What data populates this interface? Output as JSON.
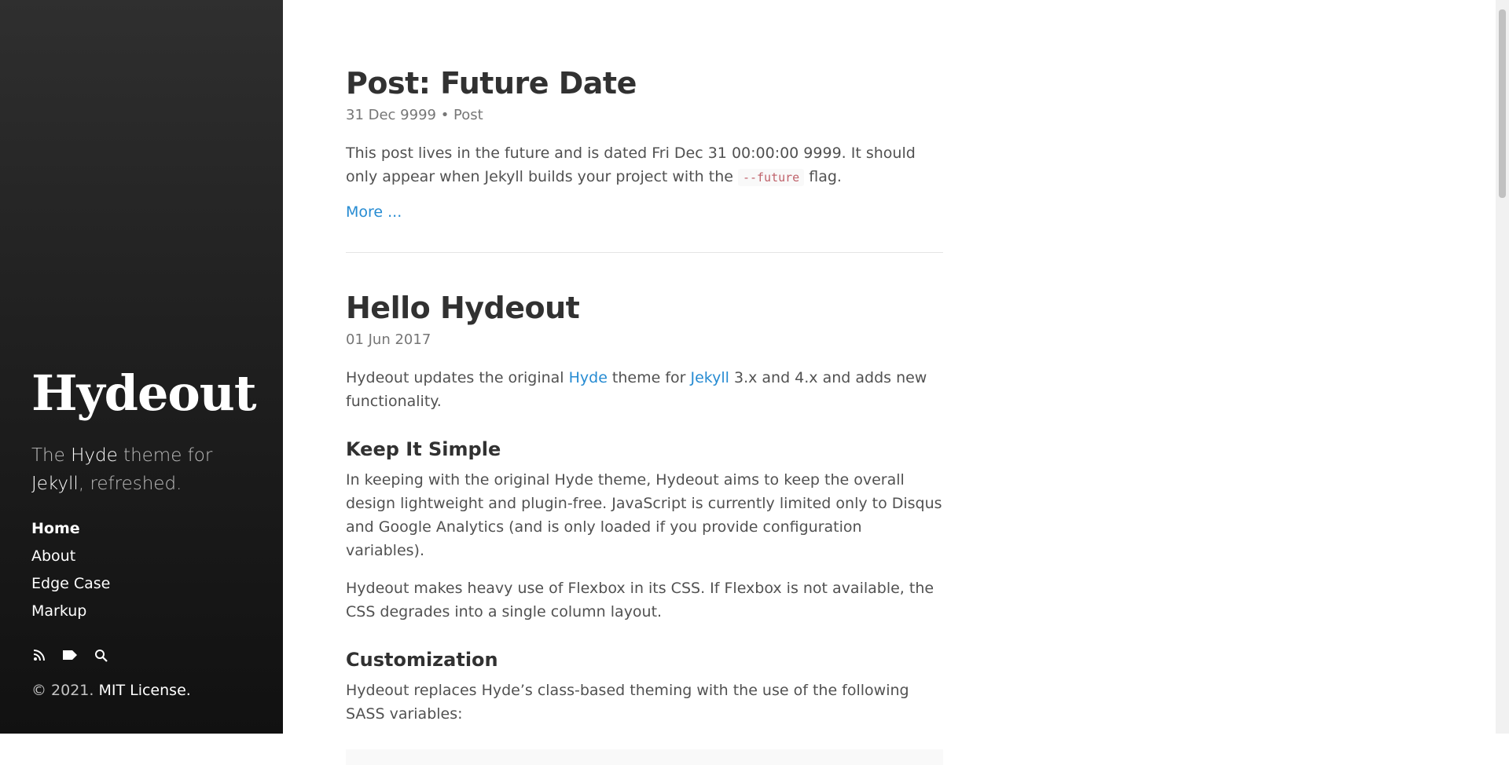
{
  "sidebar": {
    "brand": "Hydeout",
    "lead": {
      "prefix": "The ",
      "hyde": "Hyde",
      "middle": " theme for ",
      "jekyll": "Jekyll",
      "suffix": ", refreshed."
    },
    "nav": [
      "Home",
      "About",
      "Edge Case",
      "Markup"
    ],
    "icons": [
      "rss-icon",
      "tag-icon",
      "search-icon"
    ],
    "copyright_prefix": "© 2021. ",
    "license": "MIT License."
  },
  "posts": [
    {
      "title": "Post: Future Date",
      "meta": "31 Dec 9999 • Post",
      "body_before": "This post lives in the future and is dated Fri Dec 31 00:00:00 9999. It should only appear when Jekyll builds your project with the ",
      "code": "--future",
      "body_after": " flag.",
      "more": "More ..."
    },
    {
      "title": "Hello Hydeout",
      "meta": "01 Jun 2017",
      "intro": {
        "p1": "Hydeout updates the original ",
        "hyde": "Hyde",
        "p2": " theme for ",
        "jekyll": "Jekyll",
        "p3": " 3.x and 4.x and adds new functionality."
      },
      "h_simple": "Keep It Simple",
      "simple_p1": "In keeping with the original Hyde theme, Hydeout aims to keep the overall design lightweight and plugin-free. JavaScript is currently limited only to Disqus and Google Analytics (and is only loaded if you provide configuration variables).",
      "simple_p2": "Hydeout makes heavy use of Flexbox in its CSS. If Flexbox is not available, the CSS degrades into a single column layout.",
      "h_custom": "Customization",
      "custom_p1": "Hydeout replaces Hyde’s class-based theming with the use of the following SASS variables:"
    }
  ],
  "colors": {
    "link": "#268bd2",
    "code": "#bf616a",
    "sidebar_top": "#2f2f2f",
    "sidebar_bottom": "#111111"
  }
}
